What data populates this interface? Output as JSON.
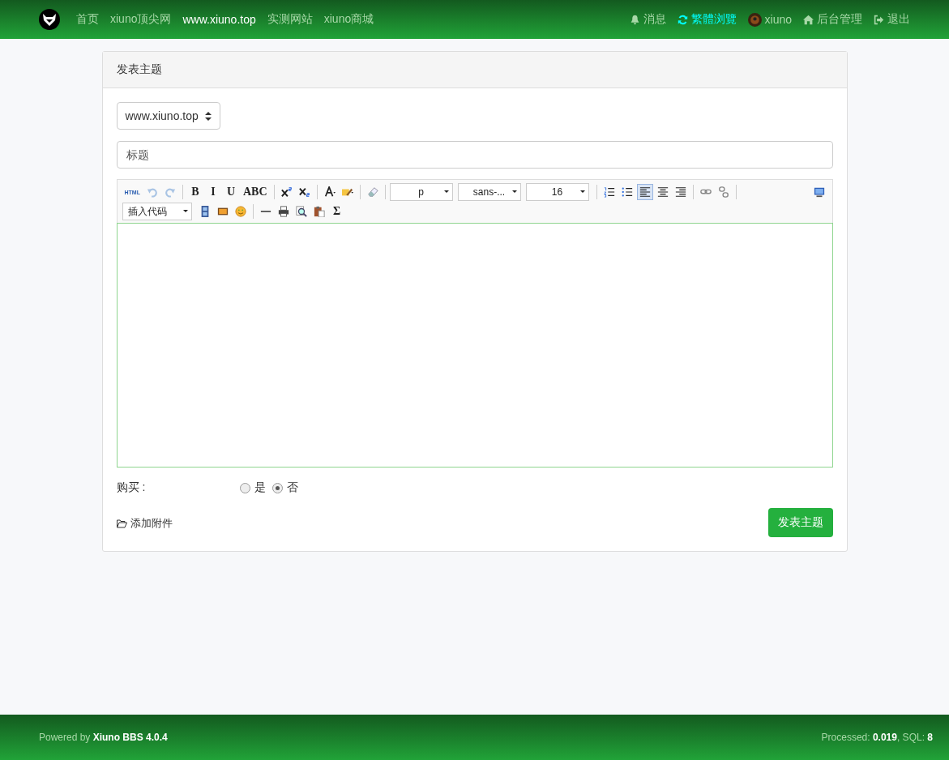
{
  "header": {
    "nav": [
      {
        "label": "首页",
        "selected": false
      },
      {
        "label": "xiuno顶尖网",
        "selected": false
      },
      {
        "label": "www.xiuno.top",
        "selected": true
      },
      {
        "label": "实测网站",
        "selected": false
      },
      {
        "label": "xiuno商城",
        "selected": false
      }
    ],
    "actions": [
      {
        "kind": "bell",
        "label": "消息",
        "active": false
      },
      {
        "kind": "refresh",
        "label": "繁體浏覽",
        "active": true
      },
      {
        "kind": "avatar",
        "label": "xiuno",
        "active": false
      },
      {
        "kind": "home",
        "label": "后台管理",
        "active": false
      },
      {
        "kind": "logout",
        "label": "退出",
        "active": false
      }
    ]
  },
  "card": {
    "title": "发表主题",
    "forum_select": {
      "value": "www.xiuno.top"
    },
    "subject": {
      "placeholder": "标题"
    },
    "toolbar": [
      [
        {
          "kind": "text",
          "label": "HTML",
          "selected": false
        },
        {
          "kind": "icon",
          "selected": false
        },
        {
          "kind": "icon",
          "selected": false
        },
        {
          "kind": "separator"
        },
        {
          "kind": "text",
          "label": "B",
          "selected": false
        },
        {
          "kind": "text",
          "label": "I",
          "selected": false
        },
        {
          "kind": "text",
          "label": "U",
          "selected": false
        },
        {
          "kind": "text",
          "label": "ABC",
          "selected": false
        },
        {
          "kind": "separator"
        },
        {
          "kind": "icon",
          "selected": false
        },
        {
          "kind": "icon",
          "selected": false
        },
        {
          "kind": "separator"
        },
        {
          "kind": "icon",
          "selected": false
        },
        {
          "kind": "icon",
          "selected": false
        },
        {
          "kind": "separator"
        },
        {
          "kind": "icon",
          "selected": false
        },
        {
          "kind": "separator"
        },
        {
          "kind": "select",
          "value": "p"
        },
        {
          "kind": "select",
          "value": "sans-..."
        },
        {
          "kind": "select",
          "value": "16"
        },
        {
          "kind": "separator"
        },
        {
          "kind": "icon",
          "selected": false
        },
        {
          "kind": "icon",
          "selected": false
        },
        {
          "kind": "icon",
          "selected": true
        },
        {
          "kind": "icon",
          "selected": false
        },
        {
          "kind": "icon",
          "selected": false
        },
        {
          "kind": "separator"
        },
        {
          "kind": "icon",
          "selected": false
        },
        {
          "kind": "icon",
          "selected": false
        },
        {
          "kind": "separator"
        },
        {
          "kind": "icon",
          "selected": false
        }
      ],
      [
        {
          "kind": "select",
          "value": "插入代码"
        },
        {
          "kind": "icon",
          "selected": false
        },
        {
          "kind": "icon",
          "selected": false
        },
        {
          "kind": "icon",
          "selected": false
        },
        {
          "kind": "separator"
        },
        {
          "kind": "icon",
          "selected": false
        },
        {
          "kind": "icon",
          "selected": false
        },
        {
          "kind": "icon",
          "selected": false
        },
        {
          "kind": "icon",
          "selected": false
        },
        {
          "kind": "text",
          "label": "Σ",
          "selected": false
        }
      ]
    ],
    "purchase": {
      "label": "购买 :",
      "options": [
        {
          "label": "是",
          "selected": false
        },
        {
          "label": "否",
          "selected": true
        }
      ]
    },
    "attach": "添加附件",
    "submit": "发表主题"
  },
  "footer": {
    "powered": "Powered by **Xiuno BBS 4.0.4**",
    "stats": "Processed: **0.019**, SQL: **8**"
  }
}
